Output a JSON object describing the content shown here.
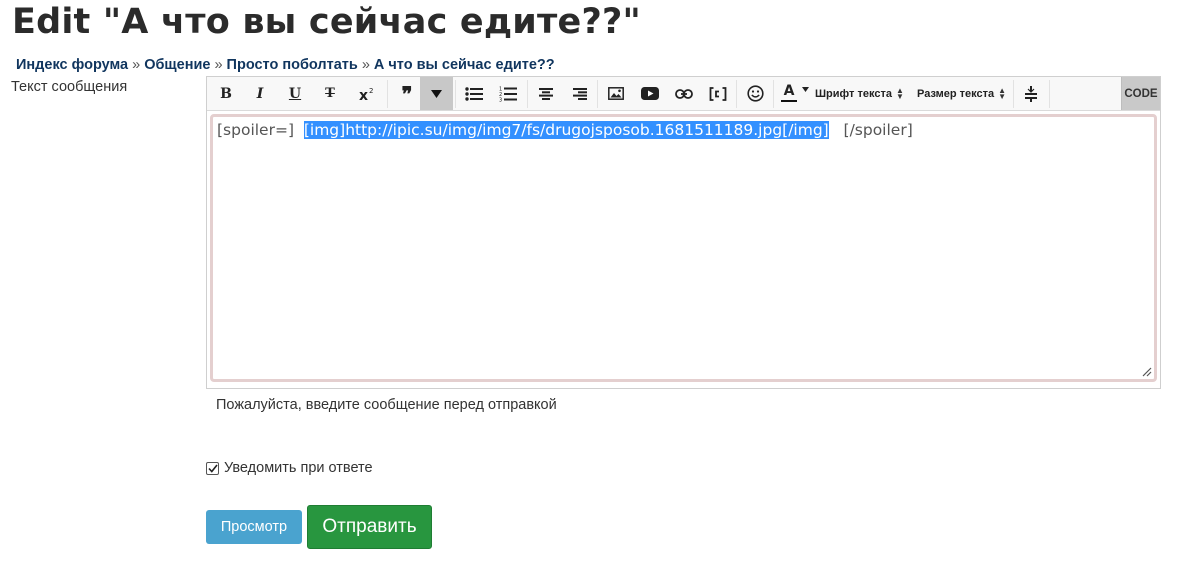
{
  "page": {
    "title": "Edit \"А что вы сейчас едите??\""
  },
  "breadcrumb": [
    {
      "label": "Индекс форума"
    },
    {
      "label": "Общение"
    },
    {
      "label": "Просто поболтать"
    },
    {
      "label": "А что вы сейчас едите??"
    }
  ],
  "breadcrumb_separator": "»",
  "form": {
    "message_label": "Текст сообщения",
    "textarea": {
      "before": "[spoiler=]  ",
      "selected": "[img]http://ipic.su/img/img7/fs/drugojsposob.1681511189.jpg[/img]",
      "after": "   [/spoiler]"
    },
    "hint": "Пожалуйста, введите сообщение перед отправкой",
    "notify_label": "Уведомить при ответе",
    "notify_checked": true
  },
  "toolbar": {
    "bold": "B",
    "italic": "I",
    "underline": "U",
    "strike": "T",
    "quote": "❞",
    "font_select": "Шрифт текста",
    "size_select": "Размер текста",
    "code": "CODE",
    "text_color": "A"
  },
  "buttons": {
    "preview": "Просмотр",
    "submit": "Отправить"
  },
  "colors": {
    "breadcrumb_link": "#10355e",
    "preview_button": "#4aa3cf",
    "submit_button": "#28963f",
    "selection": "#3390ff"
  }
}
